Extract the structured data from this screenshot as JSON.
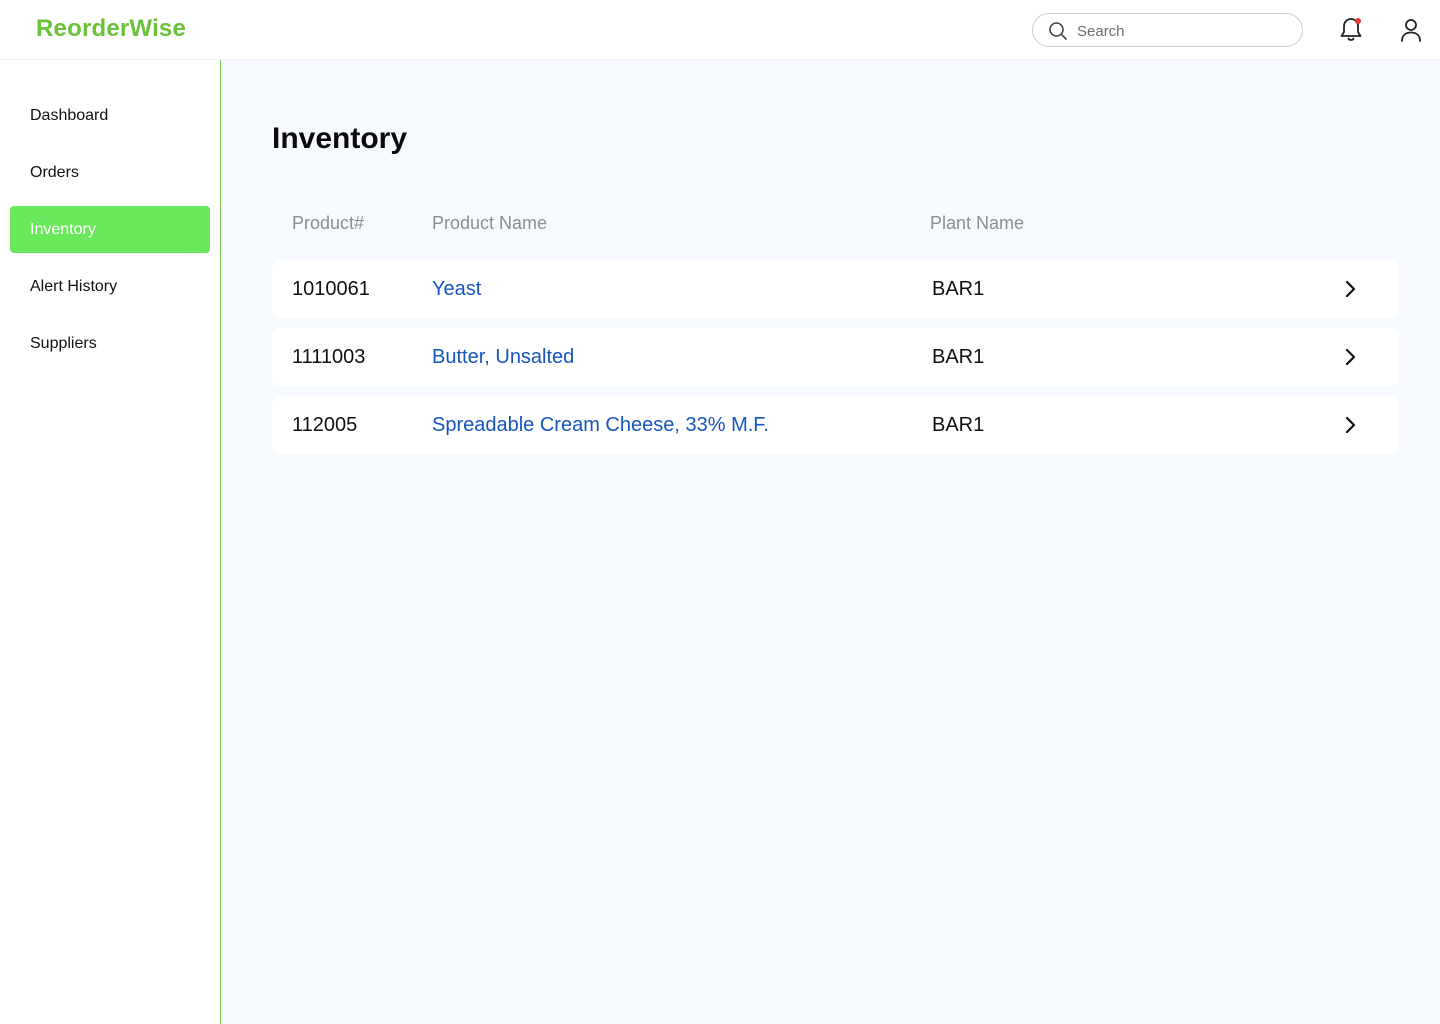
{
  "app": {
    "brand": "ReorderWise"
  },
  "header": {
    "search_placeholder": "Search",
    "icons": [
      "search-icon",
      "bell-icon",
      "user-icon"
    ],
    "notification_dot_color": "#e53935"
  },
  "sidebar": {
    "items": [
      {
        "label": "Dashboard",
        "active": false
      },
      {
        "label": "Orders",
        "active": false
      },
      {
        "label": "Inventory",
        "active": true
      },
      {
        "label": "Alert History",
        "active": false
      },
      {
        "label": "Suppliers",
        "active": false
      }
    ]
  },
  "main": {
    "title": "Inventory",
    "columns": [
      "Product#",
      "Product Name",
      "Plant Name"
    ],
    "rows": [
      {
        "product_no": "1010061",
        "product_name": "Yeast",
        "plant": "BAR1"
      },
      {
        "product_no": "1111003",
        "product_name": "Butter, Unsalted",
        "plant": "BAR1"
      },
      {
        "product_no": "112005",
        "product_name": "Spreadable Cream Cheese, 33% M.F.",
        "plant": "BAR1"
      }
    ]
  },
  "colors": {
    "brand": "#6ac13a",
    "active_nav": "#68e85a",
    "link": "#1555c0",
    "main_bg": "#f6f9fd"
  }
}
